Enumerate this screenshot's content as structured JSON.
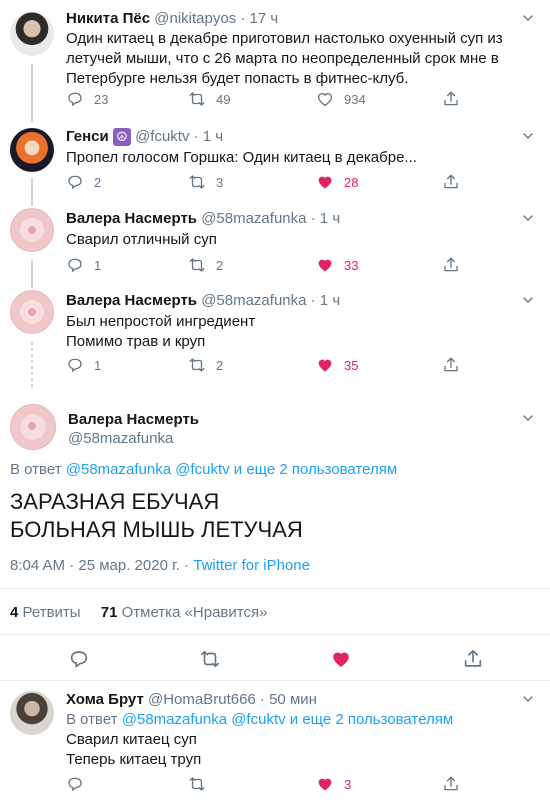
{
  "tweets": [
    {
      "name": "Никита Пёс",
      "handle": "@nikitapyos · 17 ч",
      "text": [
        "Один китаец в декабре приготовил настолько охуенный суп из",
        "летучей мыши, что с 26 марта по неопределенный срок мне в",
        "Петербурге нельзя будет попасть в фитнес-клуб."
      ],
      "replies": "23",
      "retweets": "49",
      "likes": "934",
      "liked": false
    },
    {
      "name": "Генси",
      "emoji": "☮",
      "handle": "@fcuktv · 1 ч",
      "text": [
        "Пропел голосом Горшка: Один китаец в декабре..."
      ],
      "replies": "2",
      "retweets": "3",
      "likes": "28",
      "liked": true
    },
    {
      "name": "Валера Насмерть",
      "handle": "@58mazafunka · 1 ч",
      "text": [
        "Сварил отличный суп"
      ],
      "replies": "1",
      "retweets": "2",
      "likes": "33",
      "liked": true
    },
    {
      "name": "Валера Насмерть",
      "handle": "@58mazafunka · 1 ч",
      "text": [
        "Был непростой ингредиент",
        "Помимо трав и круп"
      ],
      "replies": "1",
      "retweets": "2",
      "likes": "35",
      "liked": true
    }
  ],
  "main": {
    "name": "Валера Насмерть",
    "handle": "@58mazafunka",
    "reply_prefix": "В ответ",
    "reply_to": "@58mazafunka @fcuktv и еще 2 пользователям",
    "text": [
      "ЗАРАЗНАЯ ЕБУЧАЯ",
      "БОЛЬНАЯ МЫШЬ ЛЕТУЧАЯ"
    ],
    "time": "8:04 AM · 25 мар. 2020 г. ·",
    "source": "Twitter for iPhone",
    "retweets_count": "4",
    "retweets_label": "Ретвиты",
    "likes_count": "71",
    "likes_label": "Отметка «Нравится»"
  },
  "reply": {
    "name": "Хома Брут",
    "handle": "@HomaBrut666 · 50 мин",
    "reply_prefix": "В ответ",
    "reply_to": "@58mazafunka @fcuktv и еще 2 пользователям",
    "text": [
      "Сварил китаец суп",
      "Теперь китаец труп"
    ],
    "likes": "3",
    "liked": true
  },
  "colors": {
    "accent": "#1da1f2",
    "like": "#e0245e",
    "muted": "#657786"
  }
}
